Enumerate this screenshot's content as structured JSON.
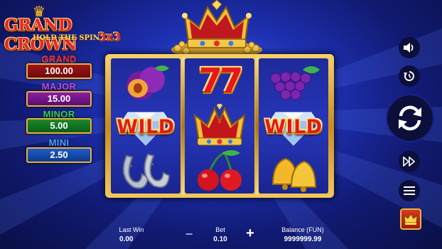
{
  "logo": {
    "title": "GRAND CROWN",
    "subtitle": "HOLD THE SPIN",
    "variant": "3x3"
  },
  "jackpots": [
    {
      "label": "GRAND",
      "value": "100.00",
      "color": "#e8262e"
    },
    {
      "label": "MAJOR",
      "value": "15.00",
      "color": "#c24ae0"
    },
    {
      "label": "MINOR",
      "value": "5.00",
      "color": "#3ad24a"
    },
    {
      "label": "MINI",
      "value": "2.50",
      "color": "#4fa3ff"
    }
  ],
  "reels": [
    [
      "plum-icon",
      "diamond-wild",
      "horseshoe-icon"
    ],
    [
      "seven-icon",
      "crown-icon",
      "cherry-icon"
    ],
    [
      "grapes-icon",
      "diamond-wild",
      "bell-icon"
    ]
  ],
  "symbols": {
    "wild": "WILD",
    "seven": "77"
  },
  "right_controls": [
    "sound-icon",
    "history-icon",
    "spin-icon",
    "autoplay-icon",
    "menu-icon",
    "buy-feature-icon"
  ],
  "bottom": {
    "last_win_label": "Last Win",
    "last_win_value": "0.00",
    "bet_label": "Bet",
    "bet_value": "0.10",
    "minus": "−",
    "plus": "+",
    "balance_label": "Balance (FUN)",
    "balance_value": "9999999.99"
  },
  "colors": {
    "background": "#1d2fb0",
    "frame_gold": "#e2b040",
    "reel_bg": "#2636b8",
    "wild_red": "#e11a1f"
  }
}
